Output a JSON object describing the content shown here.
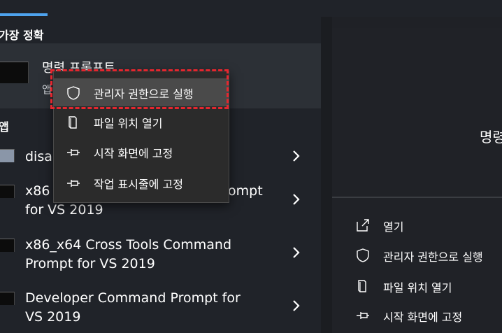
{
  "start_menu": {
    "best_match": {
      "section_title": "가장 정확",
      "app_name": "명령 프롬프트",
      "app_type": "앱"
    },
    "apps": {
      "section_title": "앱",
      "items": [
        {
          "label": "disal"
        },
        {
          "label": "x86 ompt\nfor VS 2019",
          "line1": "x86",
          "line1_tail": "ompt",
          "line2": "for VS 2019"
        },
        {
          "line1": "x86_x64 Cross Tools Command",
          "line2": "Prompt for VS 2019"
        },
        {
          "line1": "Developer Command Prompt for",
          "line2": "VS 2019"
        }
      ]
    },
    "context_menu": {
      "items": [
        {
          "label": "관리자 권한으로 실행",
          "icon": "shield-icon",
          "active": true
        },
        {
          "label": "파일 위치 열기",
          "icon": "folder-location-icon"
        },
        {
          "label": "시작 화면에 고정",
          "icon": "pin-icon"
        },
        {
          "label": "작업 표시줄에 고정",
          "icon": "pin-icon"
        }
      ]
    },
    "preview": {
      "title": "명령",
      "actions": [
        {
          "label": "열기",
          "icon": "open-icon"
        },
        {
          "label": "관리자 권한으로 실행",
          "icon": "shield-icon"
        },
        {
          "label": "파일 위치 열기",
          "icon": "folder-location-icon"
        },
        {
          "label": "시작 화면에 고정",
          "icon": "pin-icon"
        }
      ]
    }
  },
  "colors": {
    "accent": "#4ea3ee",
    "highlight_border": "#e5262e",
    "menu_bg": "#2b2b2b",
    "menu_active": "#4a4a4a"
  }
}
